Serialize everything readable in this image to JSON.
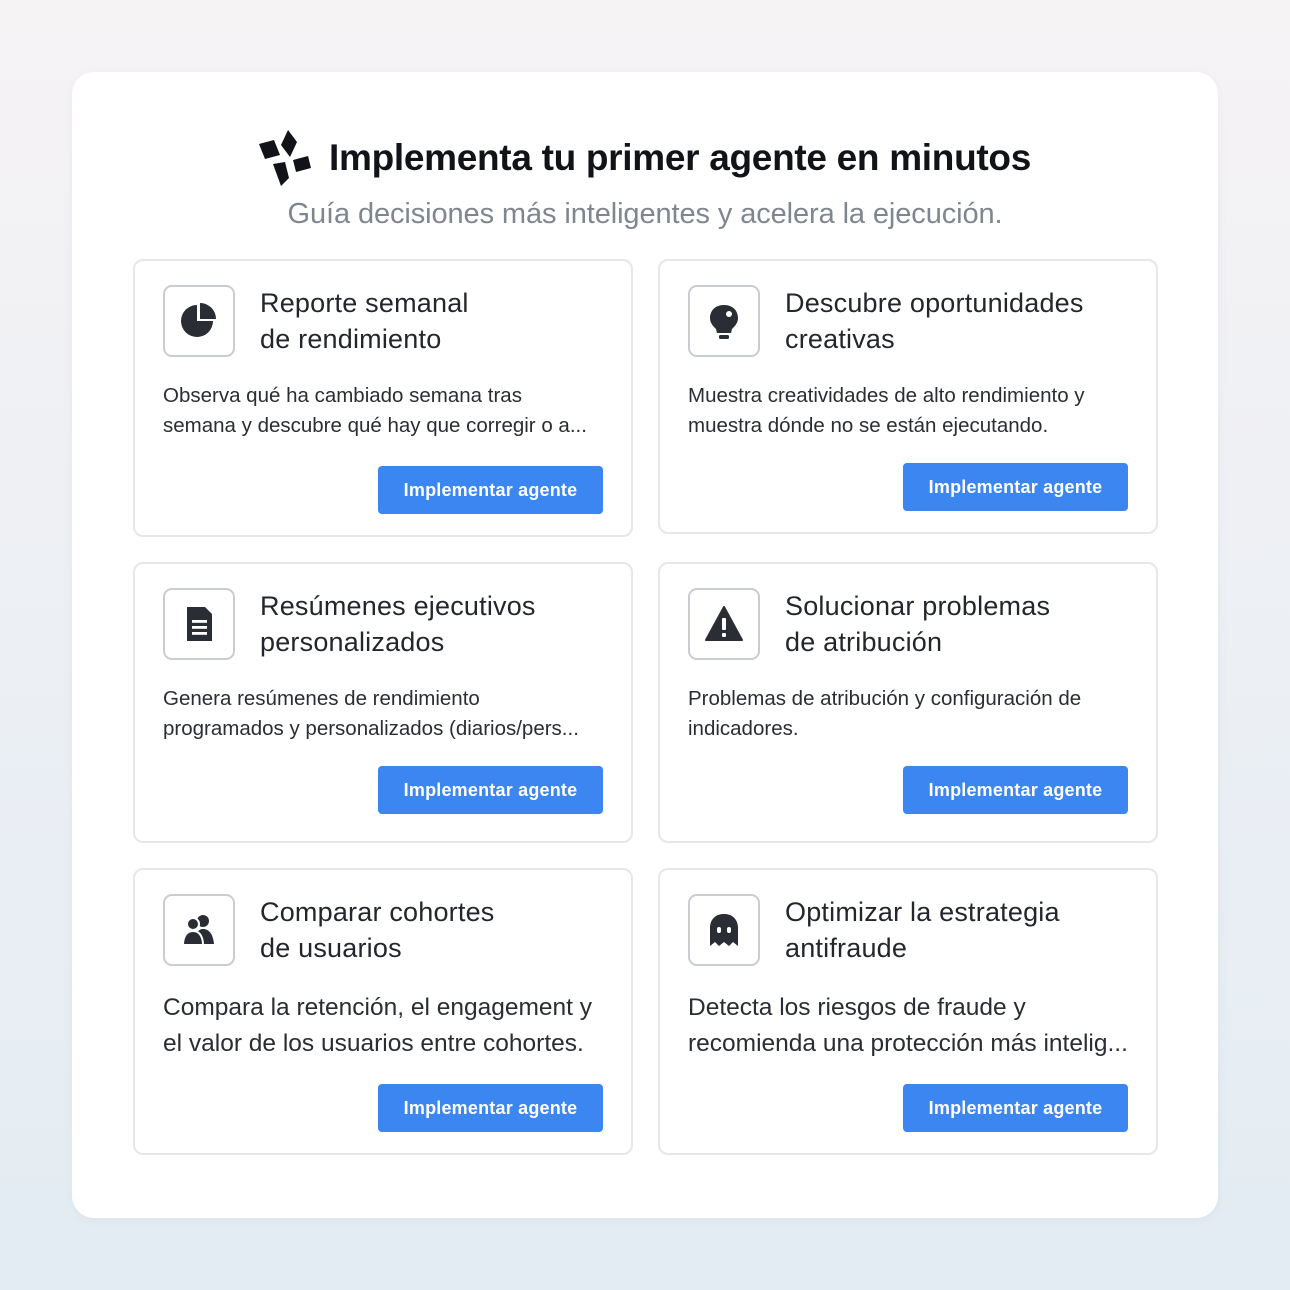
{
  "header": {
    "title": "Implementa tu primer agente en minutos",
    "subtitle": "Guía decisiones más inteligentes y acelera la ejecución.",
    "brand_icon": "sparkle-diamonds-icon"
  },
  "button_label": "Implementar agente",
  "colors": {
    "accent": "#3b86f0",
    "title_text": "#111318",
    "subtitle_text": "#80868f",
    "card_border": "#e5e7ea"
  },
  "cards": [
    {
      "icon": "pie-chart-icon",
      "title_lines": [
        "Reporte semanal",
        "de rendimiento"
      ],
      "desc_lines": [
        "Observa qué ha cambiado semana tras",
        "semana y descubre qué hay que corregir o a..."
      ],
      "button_label": "Implementar agente"
    },
    {
      "icon": "lightbulb-icon",
      "title_lines": [
        "Descubre oportunidades",
        "creativas"
      ],
      "desc_lines": [
        "Muestra creatividades de alto rendimiento y",
        "muestra dónde no se están ejecutando."
      ],
      "button_label": "Implementar agente"
    },
    {
      "icon": "document-icon",
      "title_lines": [
        "Resúmenes ejecutivos",
        "personalizados"
      ],
      "desc_lines": [
        "Genera resúmenes de rendimiento",
        "programados y personalizados (diarios/pers..."
      ],
      "button_label": "Implementar agente"
    },
    {
      "icon": "warning-triangle-icon",
      "title_lines": [
        "Solucionar problemas",
        "de atribución"
      ],
      "desc_lines": [
        "Problemas de atribución y configuración de",
        "indicadores."
      ],
      "button_label": "Implementar agente"
    },
    {
      "icon": "users-icon",
      "title_lines": [
        "Comparar cohortes",
        "de usuarios"
      ],
      "desc_lines": [
        "Compara la retención, el engagement y",
        "el valor de los usuarios entre cohortes."
      ],
      "button_label": "Implementar agente"
    },
    {
      "icon": "ghost-icon",
      "title_lines": [
        "Optimizar la estrategia",
        "antifraude"
      ],
      "desc_lines": [
        "Detecta los riesgos de fraude y",
        "recomienda una protección más intelig..."
      ],
      "button_label": "Implementar agente"
    }
  ]
}
